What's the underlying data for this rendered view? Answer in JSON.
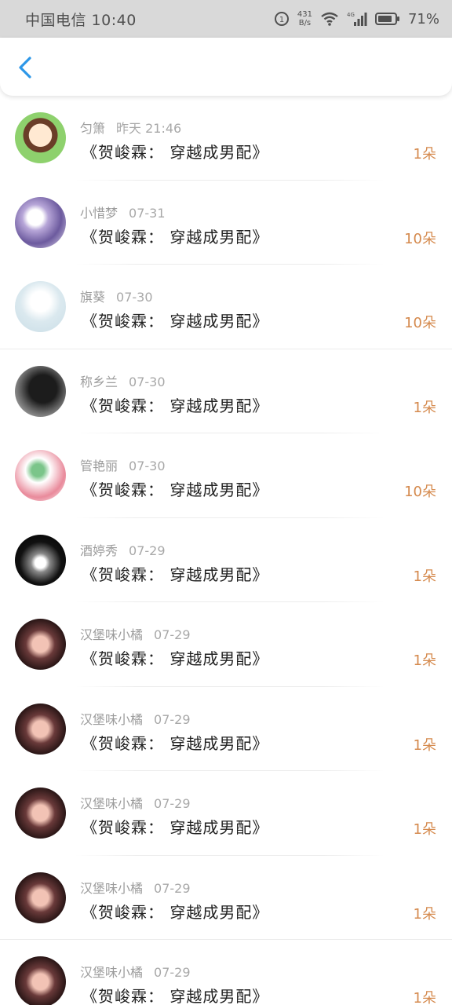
{
  "status_bar": {
    "carrier_time": "中国电信 10:40",
    "net_speed_value": "431",
    "net_speed_unit": "B/s",
    "battery_percent": "71%"
  },
  "rows": [
    {
      "name": "匀箫",
      "date": "昨天 21:46",
      "work": "《贺峻霖： 穿越成男配》",
      "amount": "1朵"
    },
    {
      "name": "小惜梦",
      "date": "07-31",
      "work": "《贺峻霖： 穿越成男配》",
      "amount": "10朵"
    },
    {
      "name": "旗葵",
      "date": "07-30",
      "work": "《贺峻霖： 穿越成男配》",
      "amount": "10朵"
    },
    {
      "name": "称乡兰",
      "date": "07-30",
      "work": "《贺峻霖： 穿越成男配》",
      "amount": "1朵"
    },
    {
      "name": "管艳丽",
      "date": "07-30",
      "work": "《贺峻霖： 穿越成男配》",
      "amount": "10朵"
    },
    {
      "name": "酒婷秀",
      "date": "07-29",
      "work": "《贺峻霖： 穿越成男配》",
      "amount": "1朵"
    },
    {
      "name": "汉堡味小橘",
      "date": "07-29",
      "work": "《贺峻霖： 穿越成男配》",
      "amount": "1朵"
    },
    {
      "name": "汉堡味小橘",
      "date": "07-29",
      "work": "《贺峻霖： 穿越成男配》",
      "amount": "1朵"
    },
    {
      "name": "汉堡味小橘",
      "date": "07-29",
      "work": "《贺峻霖： 穿越成男配》",
      "amount": "1朵"
    },
    {
      "name": "汉堡味小橘",
      "date": "07-29",
      "work": "《贺峻霖： 穿越成男配》",
      "amount": "1朵"
    },
    {
      "name": "汉堡味小橘",
      "date": "07-29",
      "work": "《贺峻霖： 穿越成男配》",
      "amount": "1朵"
    }
  ],
  "colors": {
    "accent_back": "#2d97e8",
    "amount": "#d58a4e",
    "status_bar_bg": "#d9d9d9"
  },
  "icons": {
    "back": "chevron-left-icon",
    "data_saver": "data-saver-icon",
    "wifi": "wifi-icon",
    "signal": "cellular-signal-icon",
    "battery": "battery-icon"
  }
}
